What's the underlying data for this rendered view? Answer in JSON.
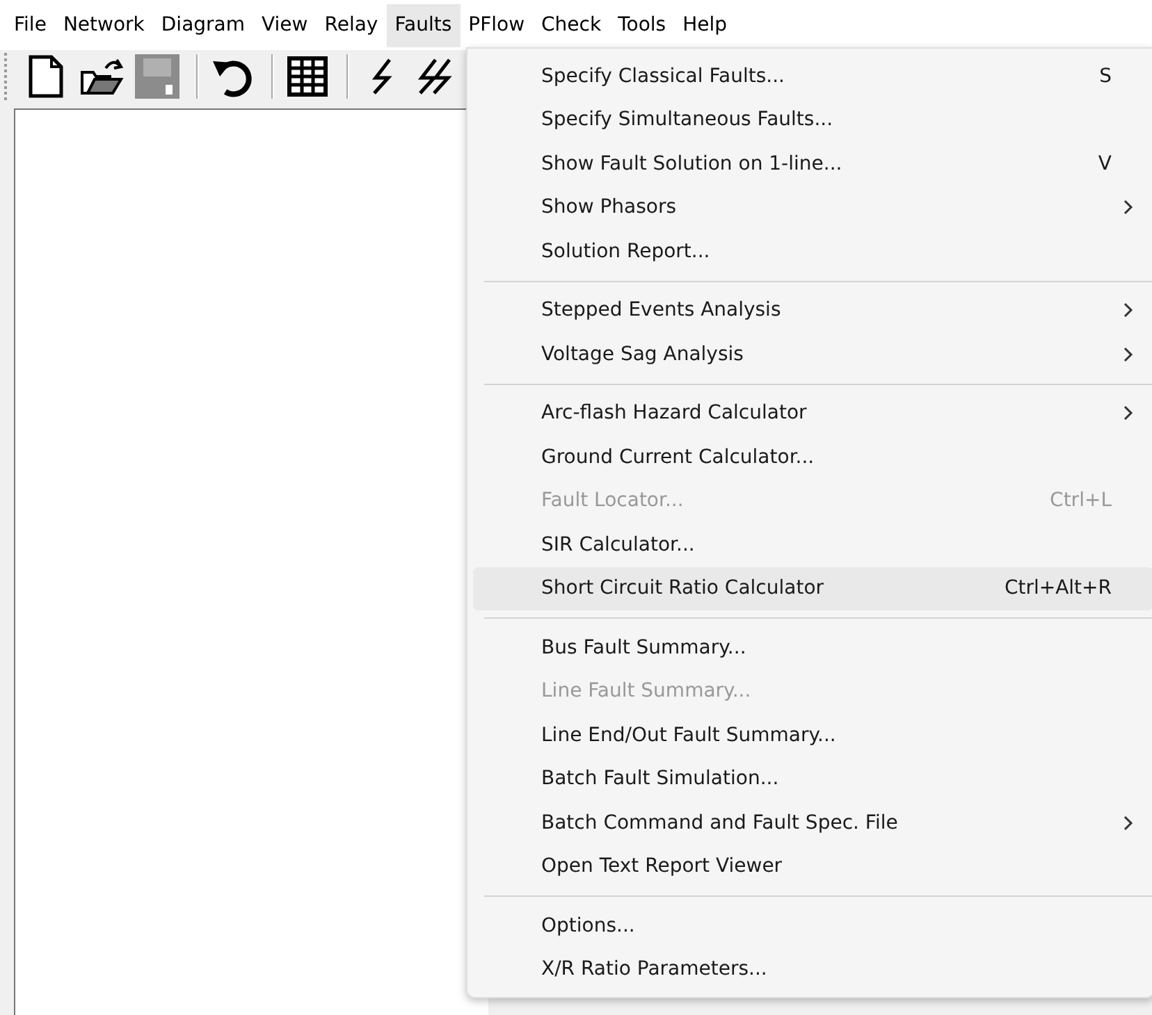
{
  "menubar": [
    {
      "label": "File",
      "selected": false
    },
    {
      "label": "Network",
      "selected": false
    },
    {
      "label": "Diagram",
      "selected": false
    },
    {
      "label": "View",
      "selected": false
    },
    {
      "label": "Relay",
      "selected": false
    },
    {
      "label": "Faults",
      "selected": true
    },
    {
      "label": "PFlow",
      "selected": false
    },
    {
      "label": "Check",
      "selected": false
    },
    {
      "label": "Tools",
      "selected": false
    },
    {
      "label": "Help",
      "selected": false
    }
  ],
  "toolbar": [
    {
      "kind": "new",
      "disabled": false
    },
    {
      "kind": "open",
      "disabled": false
    },
    {
      "kind": "save",
      "disabled": true
    },
    {
      "kind": "separator"
    },
    {
      "kind": "undo",
      "disabled": false
    },
    {
      "kind": "separator"
    },
    {
      "kind": "table",
      "disabled": false
    },
    {
      "kind": "separator"
    },
    {
      "kind": "fault",
      "disabled": false
    },
    {
      "kind": "faults",
      "disabled": false
    }
  ],
  "menu": {
    "sections": [
      {
        "items": [
          {
            "label": "Specify Classical Faults...",
            "shortcut": "S",
            "submenu": false,
            "disabled": false,
            "highlighted": false
          },
          {
            "label": "Specify Simultaneous Faults...",
            "submenu": false,
            "disabled": false,
            "highlighted": false
          },
          {
            "label": "Show Fault Solution on 1-line...",
            "shortcut": "V",
            "submenu": false,
            "disabled": false,
            "highlighted": false
          },
          {
            "label": "Show Phasors",
            "submenu": true,
            "disabled": false,
            "highlighted": false
          },
          {
            "label": "Solution Report...",
            "submenu": false,
            "disabled": false,
            "highlighted": false
          }
        ]
      },
      {
        "items": [
          {
            "label": "Stepped Events Analysis",
            "submenu": true,
            "disabled": false,
            "highlighted": false
          },
          {
            "label": "Voltage Sag Analysis",
            "submenu": true,
            "disabled": false,
            "highlighted": false
          }
        ]
      },
      {
        "items": [
          {
            "label": "Arc-flash Hazard Calculator",
            "submenu": true,
            "disabled": false,
            "highlighted": false
          },
          {
            "label": "Ground Current Calculator...",
            "submenu": false,
            "disabled": false,
            "highlighted": false
          },
          {
            "label": "Fault Locator...",
            "shortcut": "Ctrl+L",
            "submenu": false,
            "disabled": true,
            "highlighted": false
          },
          {
            "label": "SIR Calculator...",
            "submenu": false,
            "disabled": false,
            "highlighted": false
          },
          {
            "label": "Short Circuit Ratio Calculator",
            "shortcut": "Ctrl+Alt+R",
            "submenu": false,
            "disabled": false,
            "highlighted": true
          }
        ]
      },
      {
        "items": [
          {
            "label": "Bus Fault Summary...",
            "submenu": false,
            "disabled": false,
            "highlighted": false
          },
          {
            "label": "Line Fault Summary...",
            "submenu": false,
            "disabled": true,
            "highlighted": false
          },
          {
            "label": "Line End/Out Fault Summary...",
            "submenu": false,
            "disabled": false,
            "highlighted": false
          },
          {
            "label": "Batch Fault Simulation...",
            "submenu": false,
            "disabled": false,
            "highlighted": false
          },
          {
            "label": "Batch Command and Fault Spec. File",
            "submenu": true,
            "disabled": false,
            "highlighted": false
          },
          {
            "label": "Open Text Report Viewer",
            "submenu": false,
            "disabled": false,
            "highlighted": false
          }
        ]
      },
      {
        "items": [
          {
            "label": "Options...",
            "submenu": false,
            "disabled": false,
            "highlighted": false
          },
          {
            "label": "X/R Ratio Parameters...",
            "submenu": false,
            "disabled": false,
            "highlighted": false
          }
        ]
      }
    ]
  }
}
